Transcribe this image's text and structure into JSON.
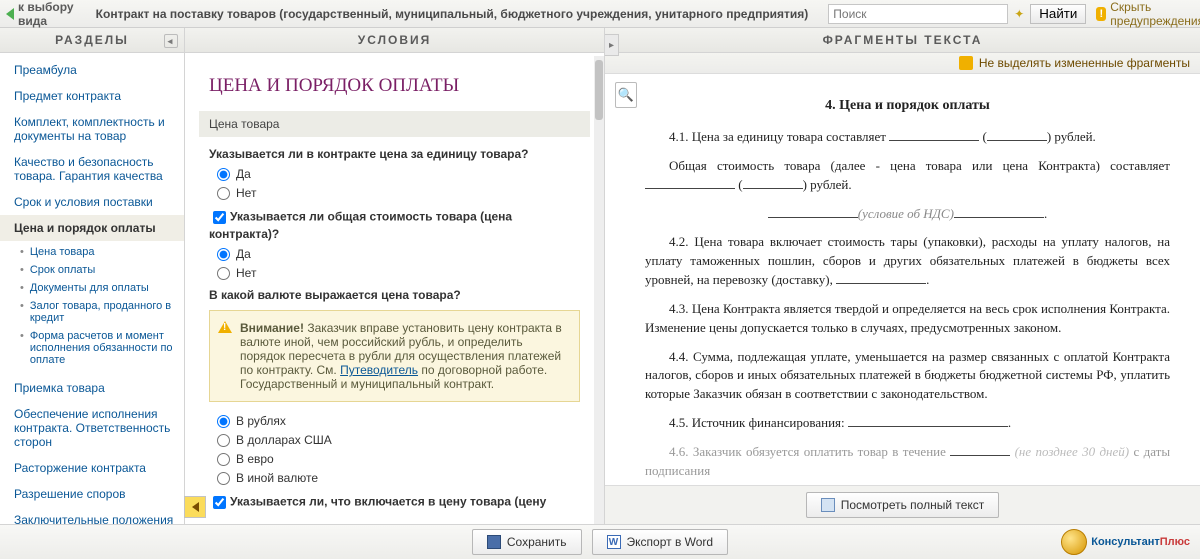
{
  "top": {
    "back": "Вернуться к выбору вида договора",
    "title": "Контракт на поставку товаров (государственный, муниципальный, бюджетного учреждения, унитарного предприятия)",
    "search_placeholder": "Поиск",
    "find": "Найти",
    "hide_warnings": "Скрыть предупреждения"
  },
  "left": {
    "header": "РАЗДЕЛЫ",
    "items": [
      {
        "label": "Преамбула"
      },
      {
        "label": "Предмет контракта"
      },
      {
        "label": "Комплект, комплектность и документы на товар"
      },
      {
        "label": "Качество и безопасность товара. Гарантия качества"
      },
      {
        "label": "Срок и условия поставки"
      },
      {
        "label": "Цена и порядок оплаты",
        "active": true,
        "sub": [
          {
            "label": "Цена товара"
          },
          {
            "label": "Срок оплаты"
          },
          {
            "label": "Документы для оплаты"
          },
          {
            "label": "Залог товара, проданного в кредит"
          },
          {
            "label": "Форма расчетов и момент исполнения обязанности по оплате"
          }
        ]
      },
      {
        "label": "Приемка товара"
      },
      {
        "label": "Обеспечение исполнения контракта. Ответственность сторон"
      },
      {
        "label": "Расторжение контракта"
      },
      {
        "label": "Разрешение споров"
      },
      {
        "label": "Заключительные положения"
      }
    ]
  },
  "cond": {
    "header": "УСЛОВИЯ",
    "title": "ЦЕНА И ПОРЯДОК ОПЛАТЫ",
    "section": "Цена товара",
    "q1": "Указывается ли в контракте цена за единицу товара?",
    "yes": "Да",
    "no": "Нет",
    "q2": "Указывается ли общая стоимость товара (цена контракта)?",
    "q3": "В какой валюте выражается цена товара?",
    "warn_label": "Внимание!",
    "warn_text_1": " Заказчик вправе установить цену контракта в валюте иной, чем российский рубль, и определить порядок пересчета в рубли для осуществления платежей по контракту. См. ",
    "warn_link": "Путеводитель",
    "warn_text_2": " по договорной работе. Государственный и муниципальный контракт.",
    "currency": {
      "rub": "В рублях",
      "usd": "В долларах США",
      "eur": "В евро",
      "other": "В иной валюте"
    },
    "q4": "Указывается ли, что включается в цену товара (цену"
  },
  "frag": {
    "header": "ФРАГМЕНТЫ ТЕКСТА",
    "no_highlight": "Не выделять измененные фрагменты",
    "title": "4.  Цена и порядок оплаты",
    "p41a": "4.1.  Цена за единицу товара составляет ",
    "p41b": " (",
    "p41c": ") рублей.",
    "p_total_a": "Общая стоимость товара (далее - цена товара или цена Контракта) составляет ",
    "p_total_b": " (",
    "p_total_c": ") рублей.",
    "nds": "(условие об НДС)",
    "p42": "4.2.  Цена товара включает стоимость тары (упаковки), расходы на уплату налогов, на уплату таможенных пошлин, сборов и других обязательных платежей в бюджеты всех уровней, на перевозку (доставку), ",
    "p43": "4.3.  Цена Контракта является твердой и определяется на весь срок исполнения Контракта. Изменение цены допускается только в случаях, предусмотренных законом.",
    "p44": "4.4.  Сумма, подлежащая уплате, уменьшается на размер связанных с оплатой Контракта налогов, сборов и иных обязательных платежей в бюджеты бюджетной системы РФ, уплатить которые Заказчик обязан в соответствии с законодательством.",
    "p45": "4.5.  Источник финансирования: ",
    "p46a": "4.6.  Заказчик обязуется оплатить товар в течение ",
    "p46b": "(не позднее 30 дней)",
    "p46c": " с даты подписания",
    "view_full": "Посмотреть полный текст"
  },
  "bottom": {
    "save": "Сохранить",
    "export": "Экспорт в Word"
  },
  "logo": {
    "part1": "Консультант",
    "part2": "Плюс"
  }
}
